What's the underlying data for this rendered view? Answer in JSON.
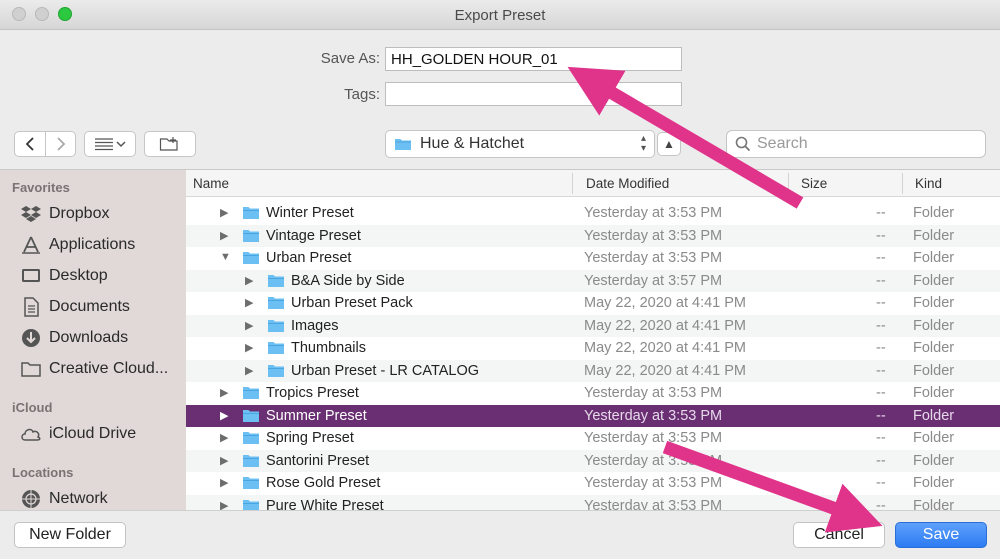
{
  "window": {
    "title": "Export Preset"
  },
  "form": {
    "save_as_label": "Save As:",
    "save_as_value": "HH_GOLDEN HOUR_01",
    "tags_label": "Tags:",
    "tags_value": ""
  },
  "toolbar": {
    "location": "Hue & Hatchet",
    "search_placeholder": "Search"
  },
  "sidebar": {
    "favorites_label": "Favorites",
    "favorites": [
      {
        "label": "Dropbox",
        "icon": "dropbox-icon"
      },
      {
        "label": "Applications",
        "icon": "applications-icon"
      },
      {
        "label": "Desktop",
        "icon": "desktop-icon"
      },
      {
        "label": "Documents",
        "icon": "documents-icon"
      },
      {
        "label": "Downloads",
        "icon": "downloads-icon"
      },
      {
        "label": "Creative Cloud...",
        "icon": "folder-icon"
      }
    ],
    "icloud_label": "iCloud",
    "icloud": [
      {
        "label": "iCloud Drive",
        "icon": "cloud-icon"
      }
    ],
    "locations_label": "Locations",
    "locations": [
      {
        "label": "Network",
        "icon": "network-icon"
      }
    ]
  },
  "columns": {
    "name": "Name",
    "date": "Date Modified",
    "size": "Size",
    "kind": "Kind"
  },
  "rows": [
    {
      "name": "Winter Preset",
      "date": "Yesterday at 3:53 PM",
      "size": "--",
      "kind": "Folder",
      "level": 0,
      "expanded": false,
      "selected": false
    },
    {
      "name": "Vintage Preset",
      "date": "Yesterday at 3:53 PM",
      "size": "--",
      "kind": "Folder",
      "level": 0,
      "expanded": false,
      "selected": false
    },
    {
      "name": "Urban Preset",
      "date": "Yesterday at 3:53 PM",
      "size": "--",
      "kind": "Folder",
      "level": 0,
      "expanded": true,
      "selected": false
    },
    {
      "name": "B&A Side by Side",
      "date": "Yesterday at 3:57 PM",
      "size": "--",
      "kind": "Folder",
      "level": 1,
      "expanded": false,
      "selected": false
    },
    {
      "name": "Urban Preset Pack",
      "date": "May 22, 2020 at 4:41 PM",
      "size": "--",
      "kind": "Folder",
      "level": 1,
      "expanded": false,
      "selected": false
    },
    {
      "name": "Images",
      "date": "May 22, 2020 at 4:41 PM",
      "size": "--",
      "kind": "Folder",
      "level": 1,
      "expanded": false,
      "selected": false
    },
    {
      "name": "Thumbnails",
      "date": "May 22, 2020 at 4:41 PM",
      "size": "--",
      "kind": "Folder",
      "level": 1,
      "expanded": false,
      "selected": false
    },
    {
      "name": "Urban Preset - LR CATALOG",
      "date": "May 22, 2020 at 4:41 PM",
      "size": "--",
      "kind": "Folder",
      "level": 1,
      "expanded": false,
      "selected": false
    },
    {
      "name": "Tropics Preset",
      "date": "Yesterday at 3:53 PM",
      "size": "--",
      "kind": "Folder",
      "level": 0,
      "expanded": false,
      "selected": false
    },
    {
      "name": "Summer Preset",
      "date": "Yesterday at 3:53 PM",
      "size": "--",
      "kind": "Folder",
      "level": 0,
      "expanded": false,
      "selected": true
    },
    {
      "name": "Spring Preset",
      "date": "Yesterday at 3:53 PM",
      "size": "--",
      "kind": "Folder",
      "level": 0,
      "expanded": false,
      "selected": false
    },
    {
      "name": "Santorini Preset",
      "date": "Yesterday at 3:53 PM",
      "size": "--",
      "kind": "Folder",
      "level": 0,
      "expanded": false,
      "selected": false
    },
    {
      "name": "Rose Gold Preset",
      "date": "Yesterday at 3:53 PM",
      "size": "--",
      "kind": "Folder",
      "level": 0,
      "expanded": false,
      "selected": false
    },
    {
      "name": "Pure White Preset",
      "date": "Yesterday at 3:53 PM",
      "size": "--",
      "kind": "Folder",
      "level": 0,
      "expanded": false,
      "selected": false
    }
  ],
  "buttons": {
    "new_folder": "New Folder",
    "cancel": "Cancel",
    "save": "Save"
  },
  "colors": {
    "selection": "#6a2f73",
    "accent": "#2d7bf4",
    "annotation_arrow": "#e0338a",
    "folder": "#6cbff2"
  }
}
